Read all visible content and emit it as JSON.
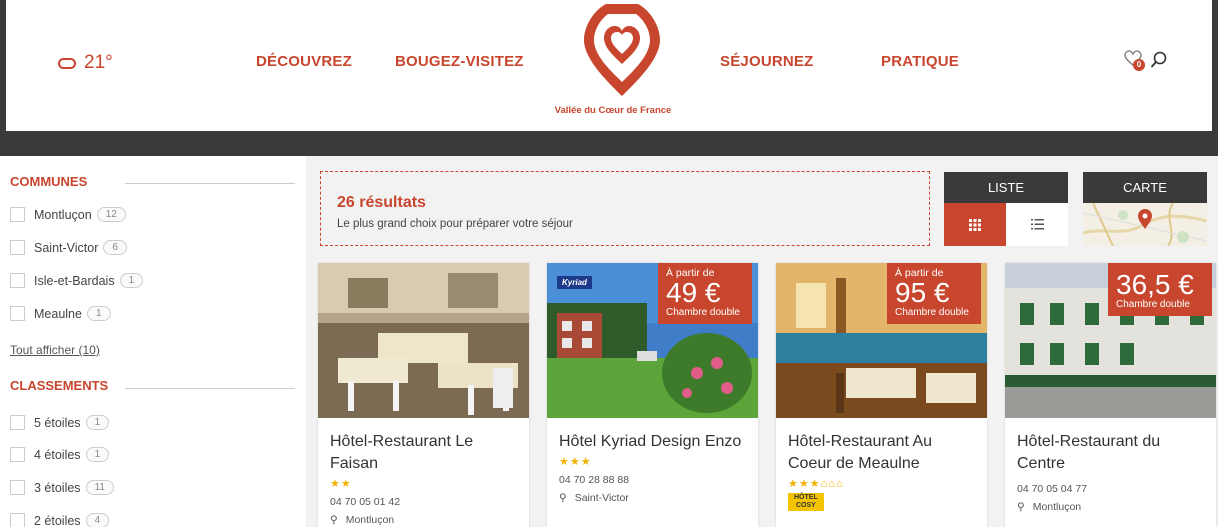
{
  "header": {
    "weather_temp": "21°",
    "nav": [
      "DÉCOUVREZ",
      "BOUGEZ-VISITEZ",
      "SÉJOURNEZ",
      "PRATIQUE"
    ],
    "logo_text": "Vallée du Cœur de France",
    "favorites_count": "0",
    "icons": [
      "cloud-icon",
      "heart-icon",
      "search-icon"
    ]
  },
  "sidebar": {
    "communes_title": "COMMUNES",
    "communes": [
      {
        "label": "Montluçon",
        "count": "12"
      },
      {
        "label": "Saint-Victor",
        "count": "6"
      },
      {
        "label": "Isle-et-Bardais",
        "count": "1"
      },
      {
        "label": "Meaulne",
        "count": "1"
      }
    ],
    "show_all": "Tout afficher (10)",
    "classements_title": "CLASSEMENTS",
    "classements": [
      {
        "label": "5 étoiles",
        "count": "1"
      },
      {
        "label": "4 étoiles",
        "count": "1"
      },
      {
        "label": "3 étoiles",
        "count": "11"
      },
      {
        "label": "2 étoiles",
        "count": "4"
      }
    ]
  },
  "results": {
    "title": "26 résultats",
    "subtitle": "Le plus grand choix pour préparer votre séjour"
  },
  "views": {
    "list_label": "LISTE",
    "map_label": "CARTE"
  },
  "cards": [
    {
      "title": "Hôtel-Restaurant Le Faisan",
      "stars": "★★",
      "phone": "04 70 05 01 42",
      "place": "Montluçon"
    },
    {
      "title": "Hôtel Kyriad Design Enzo",
      "stars": "★★★",
      "phone": "04 70 28 88 88",
      "place": "Saint-Victor",
      "price_from": "À partir de",
      "price": "49 €",
      "price_unit": "Chambre double",
      "brand": "Kyriad"
    },
    {
      "title": "Hôtel-Restaurant Au Coeur de Meaulne",
      "stars": "★★★",
      "extra": "⌂⌂⌂",
      "badge_top": "HÔTEL",
      "badge": "COSY",
      "price_from": "À partir de",
      "price": "95 €",
      "price_unit": "Chambre double"
    },
    {
      "title": "Hôtel-Restaurant du Centre",
      "phone": "04 70 05 04 77",
      "place": "Montluçon",
      "price": "36,5 €",
      "price_unit": "Chambre double"
    }
  ],
  "colors": {
    "accent": "#c8462e",
    "dark": "#3a3a3a",
    "star": "#f0b400"
  }
}
